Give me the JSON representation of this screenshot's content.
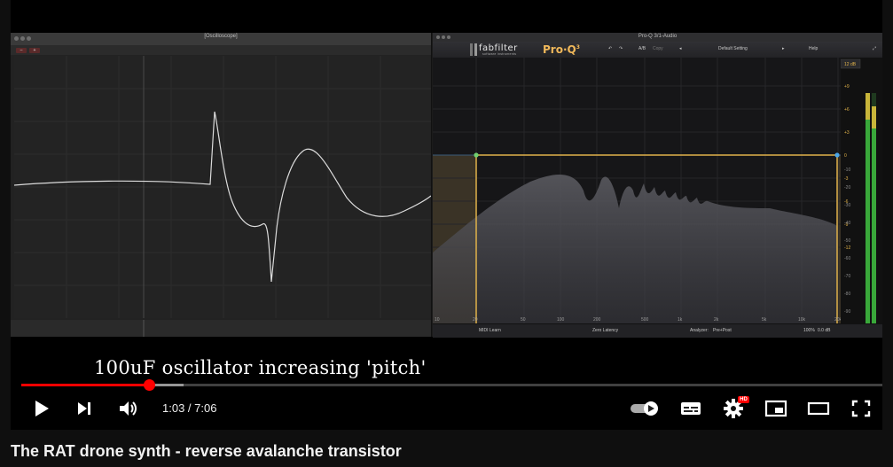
{
  "video": {
    "caption": "100uF oscillator increasing 'pitch'",
    "title": "The RAT drone synth - reverse avalanche transistor"
  },
  "oscilloscope": {
    "window_title": "[Oscilloscope]"
  },
  "proq": {
    "window_title": "Pro-Q 3/1-Audio",
    "brand": "fabfilter",
    "brand_sub": "software instruments",
    "product": "Pro·Q",
    "product_version": "3",
    "ab_label": "A/B",
    "copy_label": "Copy",
    "preset": "Default Setting",
    "help": "Help",
    "range": "12 dB",
    "db_scale": [
      "+9",
      "+6",
      "+3",
      "0",
      "-3",
      "-6",
      "-9",
      "-12"
    ],
    "db_scale_right": [
      "-10",
      "-20",
      "-30",
      "-40",
      "-50",
      "-60",
      "-70",
      "-80",
      "-90"
    ],
    "freq_labels": [
      "20",
      "50",
      "100",
      "200",
      "500",
      "1k",
      "2k",
      "5k",
      "10k",
      "20k"
    ],
    "freq_left": "10",
    "midi_learn": "MIDI Learn",
    "latency": "Zero Latency",
    "analyzer_label": "Analyzer:",
    "analyzer_value": "Pre+Post",
    "zoom": "100%",
    "gain": "0.0 dB"
  },
  "player": {
    "current_time": "1:03",
    "duration": "7:06",
    "time_display": "1:03 / 7:06",
    "progress_fraction": 0.148,
    "buffer_fraction": 0.188,
    "hd_badge": "HD",
    "accent_color": "#ff0000"
  },
  "icons": [
    "play-icon",
    "next-icon",
    "volume-icon",
    "autoplay-toggle-icon",
    "subtitles-icon",
    "settings-icon",
    "miniplayer-icon",
    "theater-icon",
    "fullscreen-icon"
  ]
}
